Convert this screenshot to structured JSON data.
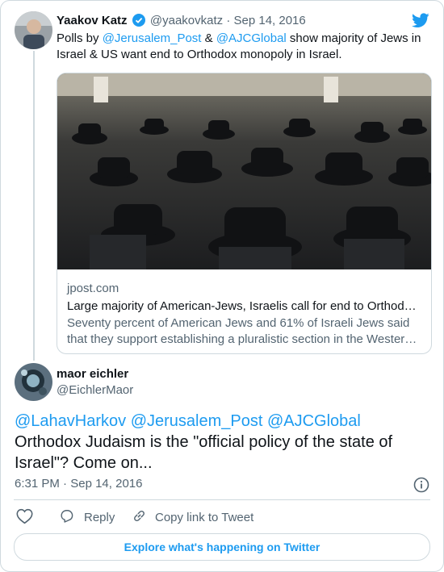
{
  "tweet_quoted": {
    "display_name": "Yaakov Katz",
    "handle": "@yaakovkatz",
    "separator": "·",
    "date": "Sep 14, 2016",
    "text_prefix": "Polls by ",
    "mention1": "@Jerusalem_Post",
    "text_and": " & ",
    "mention2": "@AJCGlobal",
    "text_rest": " show majority of Jews in Israel & US want end to Orthodox monopoly in Israel."
  },
  "link_card": {
    "domain": "jpost.com",
    "title": "Large majority of American-Jews, Israelis call for end to Orthodox monopoly",
    "description_line1": "Seventy percent of American Jews and 61% of Israeli Jews said",
    "description_line2": "that they support establishing a pluralistic section in the Western Wall"
  },
  "tweet_main": {
    "display_name": "maor eichler",
    "handle": "@EichlerMaor",
    "mentions": "@LahavHarkov @Jerusalem_Post @AJCGlobal",
    "text": "Orthodox Judaism is the \"official policy of the state of Israel\"? Come on...",
    "time": "6:31 PM",
    "separator": "·",
    "date": "Sep 14, 2016"
  },
  "actions": {
    "reply": "Reply",
    "copy_link": "Copy link to Tweet"
  },
  "footer": {
    "explore": "Explore what's happening on Twitter"
  },
  "colors": {
    "twitter_blue": "#1d9bf0",
    "verified_blue": "#1d9bf0",
    "text_gray": "#536471",
    "border": "#cfd9de"
  }
}
